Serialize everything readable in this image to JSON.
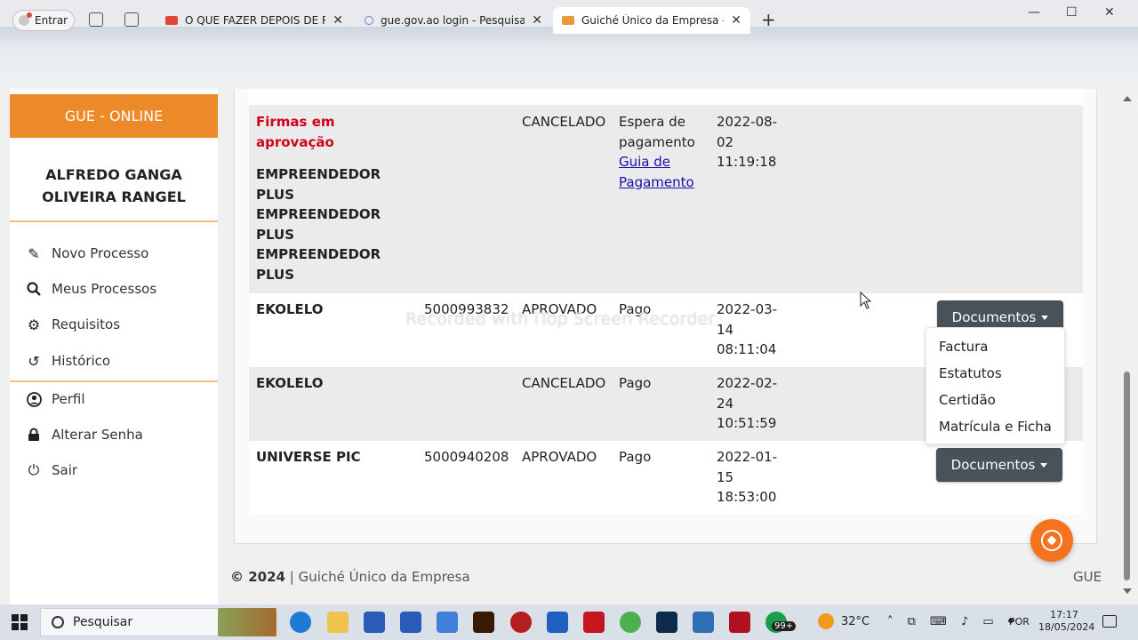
{
  "browser": {
    "profile_label": "Entrar",
    "tabs": [
      {
        "title": "O QUE FAZER DEPOIS DE REGISTAR",
        "favicon_color": "#e0443a",
        "active": false
      },
      {
        "title": "gue.gov.ao login - Pesquisar",
        "favicon_color": "#6a7cc7",
        "active": false
      },
      {
        "title": "Guiché Único da Empresa - GUE",
        "favicon_color": "#e89a3a",
        "active": true
      }
    ],
    "close_glyph": "✕",
    "new_tab_glyph": "+",
    "window_controls": [
      "—",
      "☐",
      "✕"
    ]
  },
  "sidebar": {
    "brand": "GUE - ONLINE",
    "user_line1": "ALFREDO GANGA",
    "user_line2": "OLIVEIRA RANGEL",
    "items": [
      {
        "label": "Novo Processo",
        "icon": "edit-icon"
      },
      {
        "label": "Meus Processos",
        "icon": "search-icon"
      },
      {
        "label": "Requisitos",
        "icon": "cogs-icon"
      },
      {
        "label": "Histórico",
        "icon": "history-icon"
      },
      {
        "label": "Perfil",
        "icon": "user-icon"
      },
      {
        "label": "Alterar Senha",
        "icon": "lock-icon"
      },
      {
        "label": "Sair",
        "icon": "power-icon"
      }
    ],
    "accent_color": "#ec8a2a"
  },
  "table": {
    "rows": [
      {
        "name_prefix": "Firmas em",
        "name_prefix2": "aprovação",
        "names": [
          "EMPREENDEDOR",
          "PLUS",
          "EMPREENDEDOR",
          "PLUS",
          "EMPREENDEDOR",
          "PLUS"
        ],
        "nif": "",
        "status": "CANCELADO",
        "payment_line1": "Espera de",
        "payment_line2": "pagamento",
        "payment_link1": "Guia de",
        "payment_link2": "Pagamento",
        "date": "2022-08-",
        "date2": "02",
        "time": "11:19:18"
      },
      {
        "name": "EKOLELO",
        "nif": "5000993832",
        "status": "APROVADO",
        "payment": "Pago",
        "date": "2022-03-",
        "date2": "14",
        "time": "08:11:04",
        "button": "Documentos"
      },
      {
        "name": "EKOLELO",
        "nif": "",
        "status": "CANCELADO",
        "payment": "Pago",
        "date": "2022-02-",
        "date2": "24",
        "time": "10:51:59"
      },
      {
        "name": "UNIVERSE PIC",
        "nif": "5000940208",
        "status": "APROVADO",
        "payment": "Pago",
        "date": "2022-01-",
        "date2": "15",
        "time": "18:53:00",
        "button": "Documentos"
      }
    ],
    "dropdown": [
      "Factura",
      "Estatutos",
      "Certidão",
      "Matrícula e Ficha"
    ]
  },
  "watermark": "Recorded with iTop Screen Recorder",
  "footer": {
    "copyright": "© 2024",
    "separator": "|",
    "company": "Guiché Único da Empresa",
    "right": "GUE"
  },
  "taskbar": {
    "search_label": "Pesquisar",
    "badge": "99+",
    "temperature": "32°C",
    "language": "POR",
    "time": "17:17",
    "date": "18/05/2024"
  }
}
